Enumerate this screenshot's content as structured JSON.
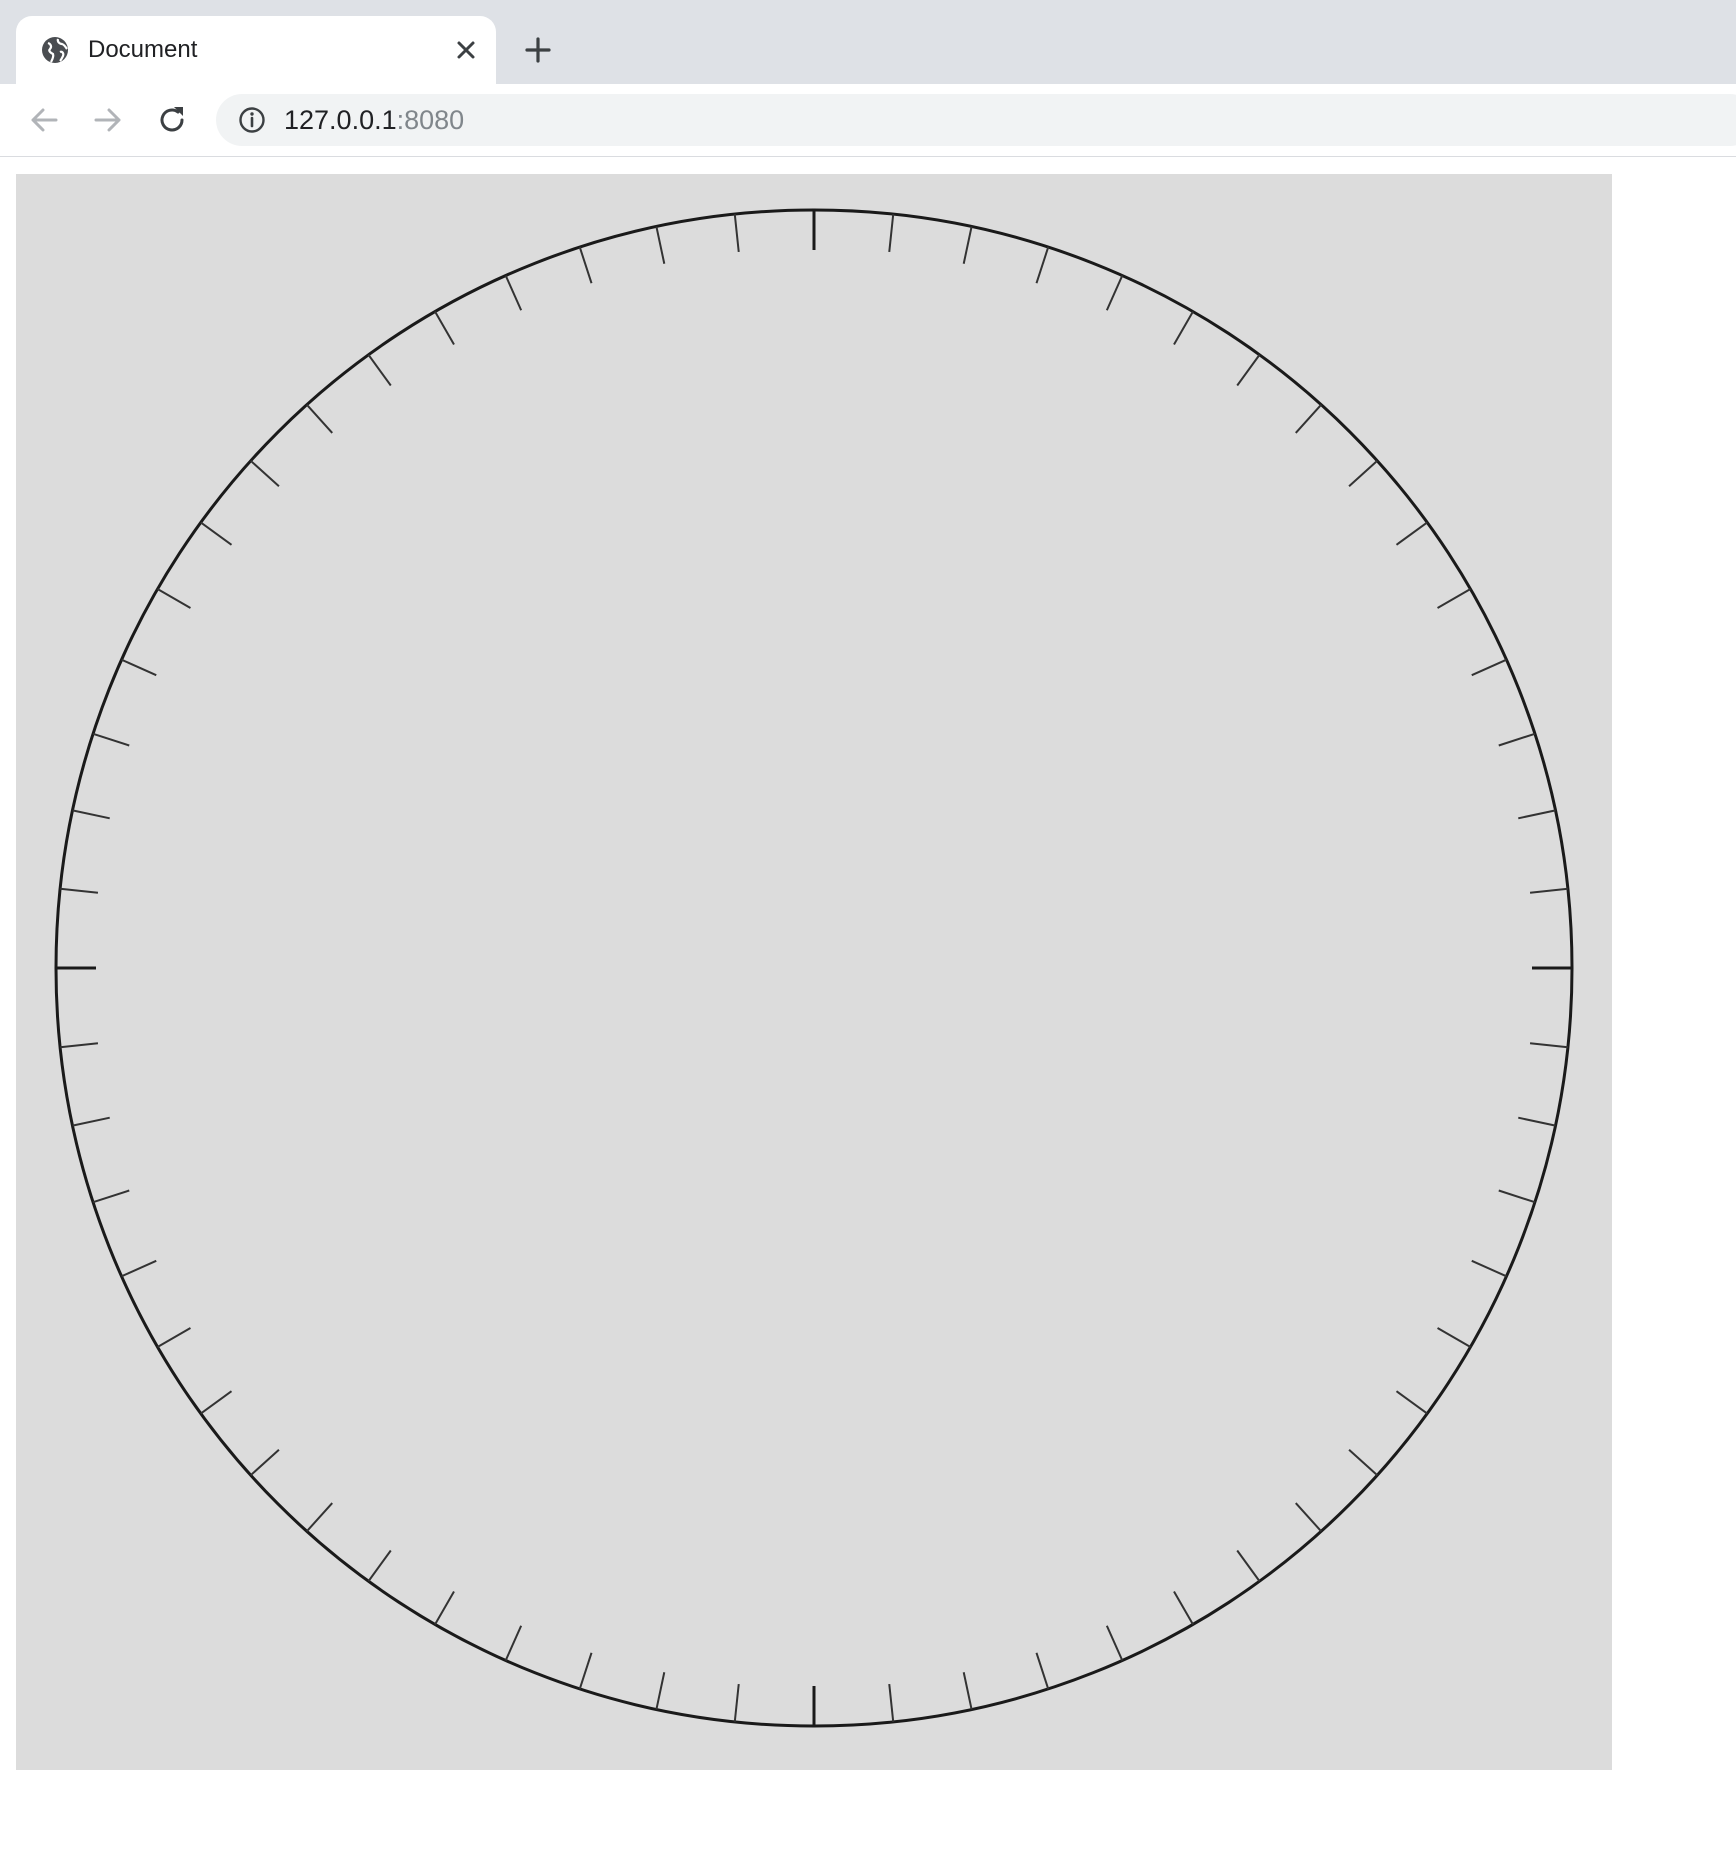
{
  "browser": {
    "tab": {
      "title": "Document",
      "favicon": "globe-icon",
      "close_icon": "close-icon"
    },
    "new_tab_icon": "plus-icon",
    "toolbar": {
      "back_icon": "arrow-left-icon",
      "forward_icon": "arrow-right-icon",
      "reload_icon": "reload-icon",
      "site_info_icon": "info-icon",
      "url_host": "127.0.0.1",
      "url_port": ":8080"
    }
  },
  "dial": {
    "tick_count": 60,
    "major_tick_every": 15,
    "background_color": "#dcdcdc",
    "stroke_color": "#1a1a1a"
  }
}
